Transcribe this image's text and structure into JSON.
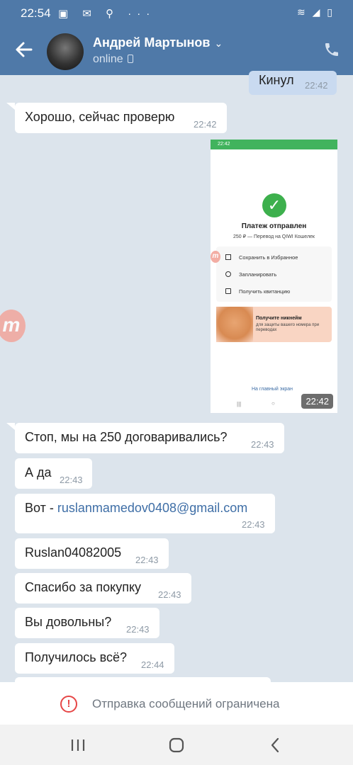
{
  "status_bar": {
    "time": "22:54",
    "icons": "▣ ✉ ⚲ ···",
    "right_icons": "≋ ◢ ▯"
  },
  "header": {
    "name": "Андрей Мартынов",
    "status": "online"
  },
  "messages": [
    {
      "text": "Кинул",
      "time": "22:42",
      "dir": "out"
    },
    {
      "text": "Хорошо, сейчас проверю",
      "time": "22:42",
      "dir": "in"
    },
    {
      "text": "Стоп, мы на 250 договаривались?",
      "time": "22:43",
      "dir": "in"
    },
    {
      "text": "А да",
      "time": "22:43",
      "dir": "in"
    },
    {
      "prefix": "Вот - ",
      "link": "ruslanmamedov0408@gmail.com",
      "time": "22:43",
      "dir": "in"
    },
    {
      "text": "Ruslan04082005",
      "time": "22:43",
      "dir": "in"
    },
    {
      "text": "Спасибо за покупку",
      "time": "22:43",
      "dir": "in"
    },
    {
      "text": "Вы довольны?",
      "time": "22:43",
      "dir": "in"
    },
    {
      "text": "Получилось всё?",
      "time": "22:44",
      "dir": "in"
    }
  ],
  "image_message": {
    "time": "22:42",
    "inner_status_time": "22:42",
    "title": "Платеж отправлен",
    "subtitle": "250 ₽ — Перевод на QIWI Кошелек",
    "menu": [
      "Сохранить в Избранное",
      "Запланировать",
      "Получить квитанцию"
    ],
    "promo_title": "Получите никнейм",
    "promo_text": "для защиты вашего номера при переводах",
    "home_link": "На главный экран"
  },
  "watermark": "m",
  "restriction": {
    "icon": "!",
    "text": "Отправка сообщений ограничена"
  },
  "colors": {
    "header": "#4f79a8",
    "background": "#dce4ec",
    "outgoing": "#c9daf0",
    "link": "#3e6ea6",
    "warning": "#e64646"
  }
}
